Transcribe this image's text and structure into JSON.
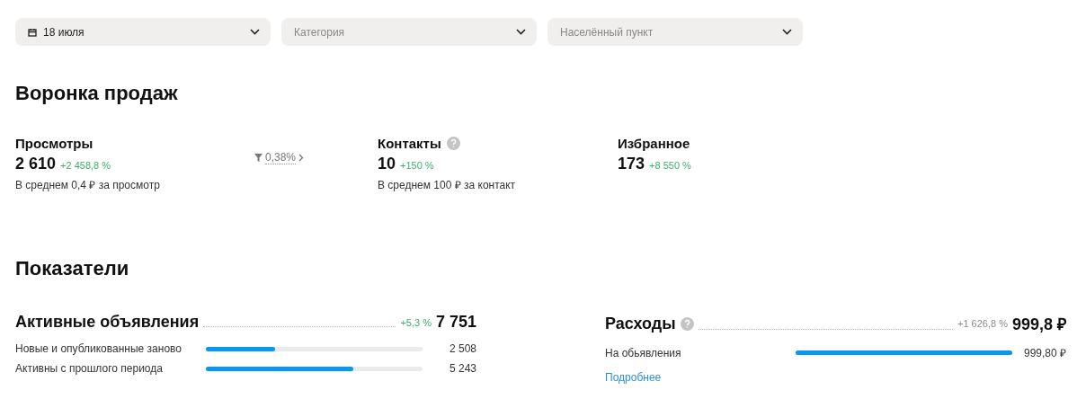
{
  "filters": [
    {
      "kind": "date",
      "value": "18 июля"
    },
    {
      "kind": "select",
      "placeholder": "Категория"
    },
    {
      "kind": "select",
      "placeholder": "Населённый пункт"
    }
  ],
  "funnel": {
    "title": "Воронка продаж",
    "items": [
      {
        "label": "Просмотры",
        "help": false,
        "value": "2 610",
        "change": "+2 458,8 %",
        "note": "В среднем 0,4 ₽ за просмотр",
        "conversion": "0,38%"
      },
      {
        "label": "Контакты",
        "help": true,
        "value": "10",
        "change": "+150 %",
        "note": "В среднем 100 ₽ за контакт"
      },
      {
        "label": "Избранное",
        "help": false,
        "value": "173",
        "change": "+8 550 %"
      }
    ]
  },
  "indicators": {
    "title": "Показатели",
    "cards": [
      {
        "label": "Активные объявления",
        "help": false,
        "change": "+5,3 %",
        "color": "#3fae6a",
        "value": "7 751",
        "rows": [
          {
            "label": "Новые и опубликованные заново",
            "level": 0.32,
            "value": "2 508"
          },
          {
            "label": "Активны с прошлого периода",
            "level": 0.68,
            "value": "5 243"
          }
        ]
      },
      {
        "label": "Расходы",
        "help": true,
        "change": "+1 626,8 %",
        "color": "#8a8a8a",
        "value": "999,8 ₽",
        "rows": [
          {
            "label": "На обьявления",
            "level": 1,
            "value": "999,80 ₽"
          }
        ],
        "link": "Подробнее"
      }
    ]
  }
}
